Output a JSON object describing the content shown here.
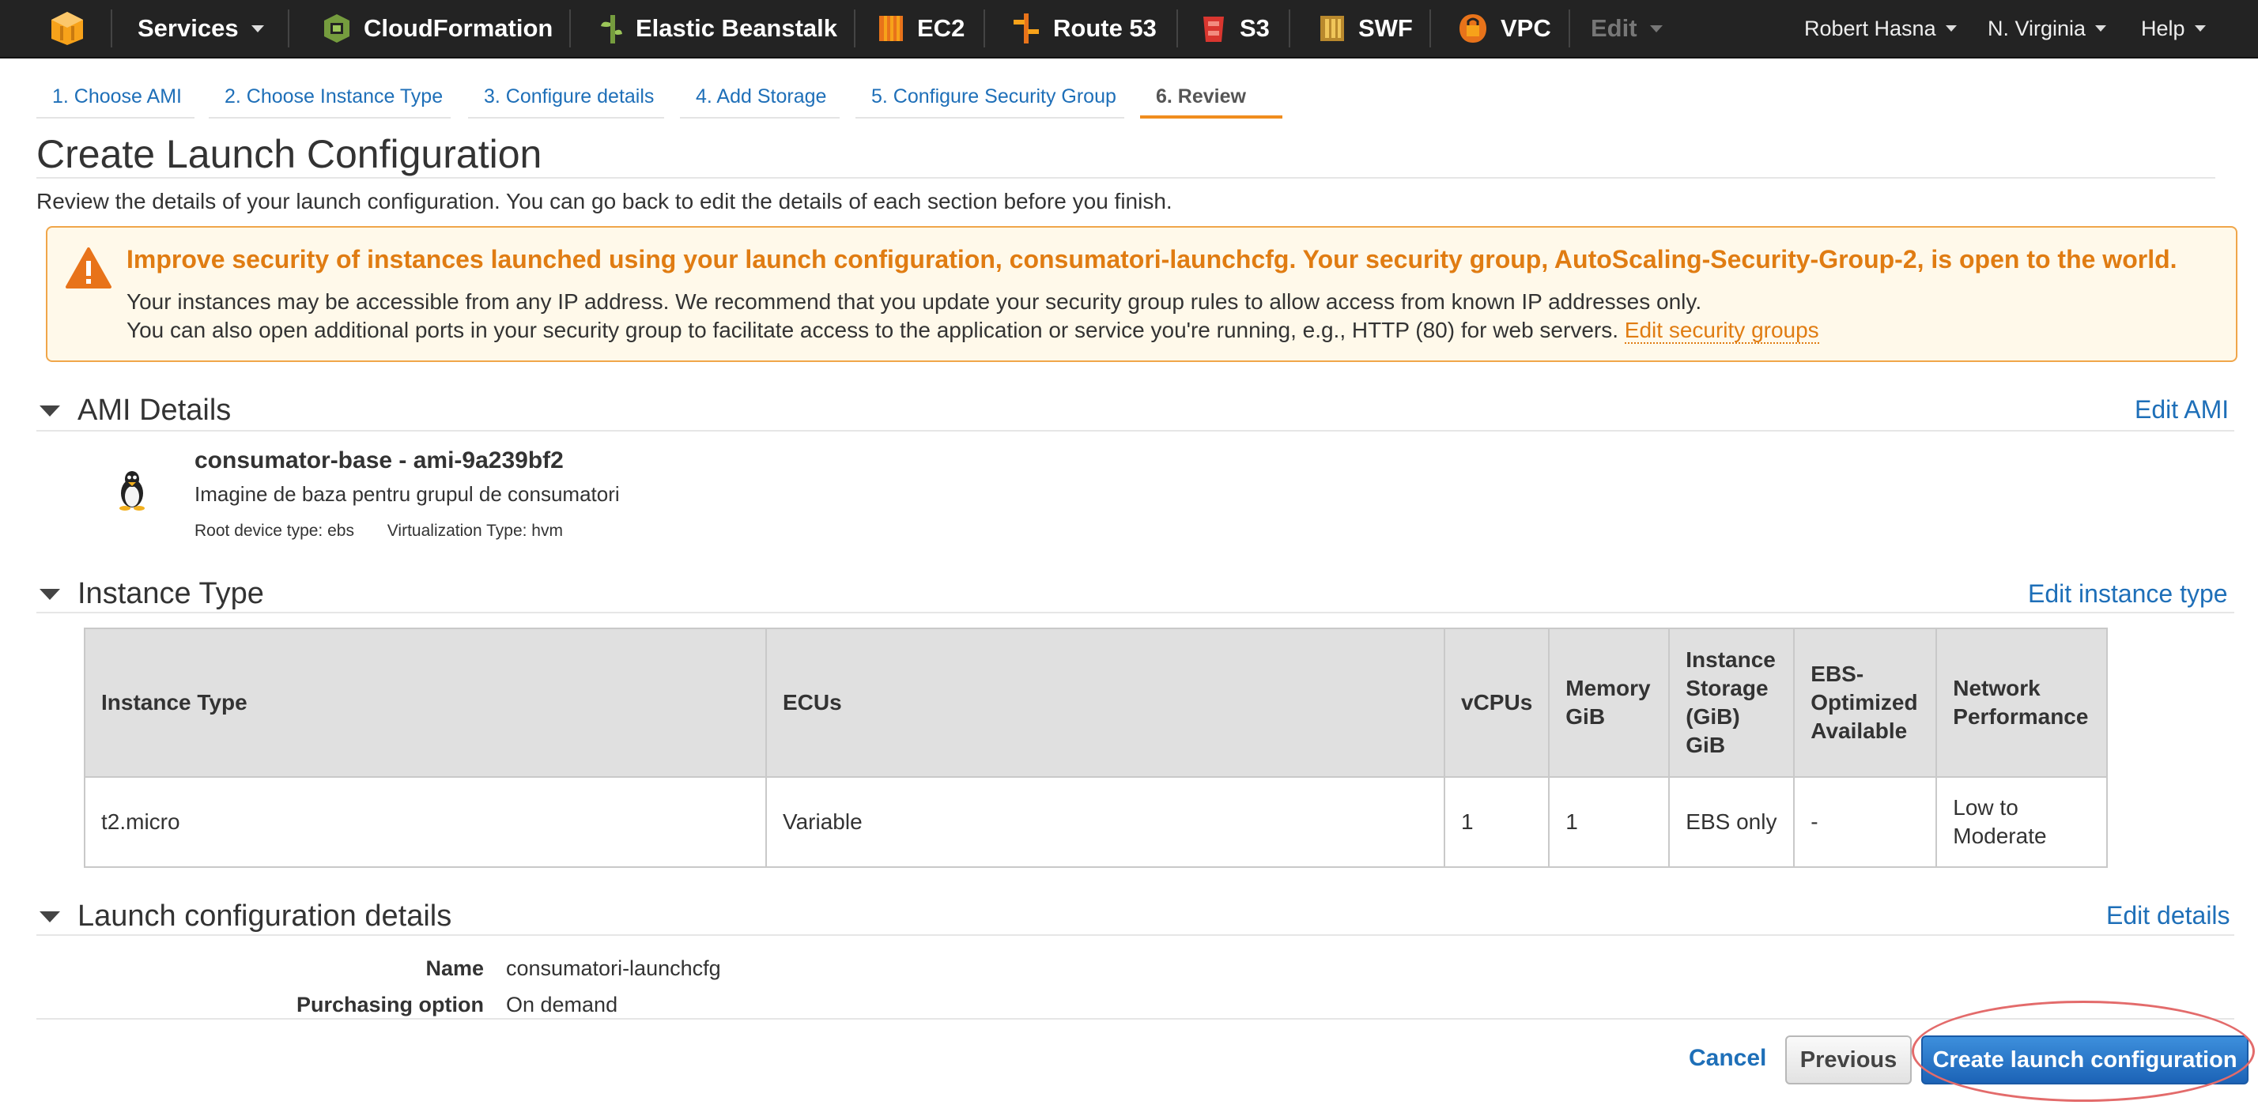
{
  "nav": {
    "services": "Services",
    "cloudformation": "CloudFormation",
    "elastic_beanstalk": "Elastic Beanstalk",
    "ec2": "EC2",
    "route53": "Route 53",
    "s3": "S3",
    "swf": "SWF",
    "vpc": "VPC",
    "edit": "Edit",
    "user": "Robert Hasna",
    "region": "N. Virginia",
    "help": "Help"
  },
  "tabs": [
    {
      "label": "1. Choose AMI"
    },
    {
      "label": "2. Choose Instance Type"
    },
    {
      "label": "3. Configure details"
    },
    {
      "label": "4. Add Storage"
    },
    {
      "label": "5. Configure Security Group"
    },
    {
      "label": "6. Review"
    }
  ],
  "page": {
    "title": "Create Launch Configuration",
    "description": "Review the details of your launch configuration. You can go back to edit the details of each section before you finish."
  },
  "warning": {
    "title": "Improve security of instances launched using your launch configuration, consumatori-launchcfg. Your security group, AutoScaling-Security-Group-2, is open to the world.",
    "line1": "Your instances may be accessible from any IP address. We recommend that you update your security group rules to allow access from known IP addresses only.",
    "line2": "You can also open additional ports in your security group to facilitate access to the application or service you're running, e.g., HTTP (80) for web servers.",
    "link": "Edit security groups"
  },
  "ami": {
    "heading": "AMI Details",
    "edit": "Edit AMI",
    "name": "consumator-base - ami-9a239bf2",
    "description": "Imagine de baza pentru grupul de consumatori",
    "root_device": "Root device type: ebs",
    "virtualization": "Virtualization Type: hvm"
  },
  "instance": {
    "heading": "Instance Type",
    "edit": "Edit instance type",
    "headers": {
      "type": "Instance Type",
      "ecus": "ECUs",
      "vcpus": "vCPUs",
      "memory_l1": "Memory",
      "memory_l2": "GiB",
      "storage_l1": "Instance",
      "storage_l2": "Storage",
      "storage_l3": "(GiB)",
      "storage_l4": "GiB",
      "ebs_l1": "EBS-",
      "ebs_l2": "Optimized",
      "ebs_l3": "Available",
      "net_l1": "Network",
      "net_l2": "Performance"
    },
    "row": {
      "type": "t2.micro",
      "ecus": "Variable",
      "vcpus": "1",
      "memory": "1",
      "storage": "EBS only",
      "ebs": "-",
      "net_l1": "Low to",
      "net_l2": "Moderate"
    }
  },
  "launch": {
    "heading": "Launch configuration details",
    "edit": "Edit details",
    "name_label": "Name",
    "name_value": "consumatori-launchcfg",
    "purchasing_label": "Purchasing option",
    "purchasing_value": "On demand"
  },
  "buttons": {
    "cancel": "Cancel",
    "previous": "Previous",
    "create": "Create launch configuration"
  },
  "colors": {
    "nav_bg": "#232323",
    "link": "#1e6fb8",
    "warning": "#e07c12",
    "primary_button": "#1c63b6",
    "active_tab": "#f08d1e",
    "highlight": "#e36b6b"
  }
}
